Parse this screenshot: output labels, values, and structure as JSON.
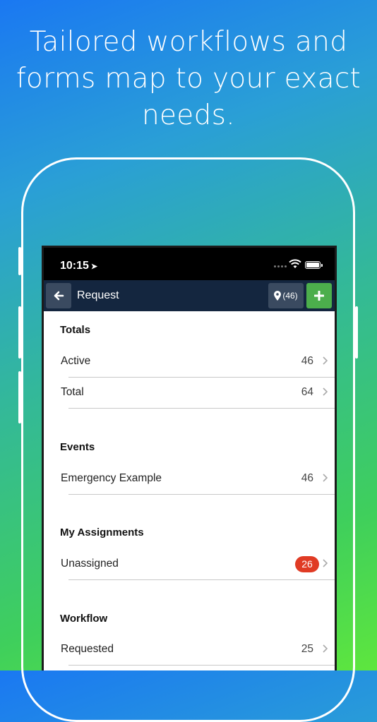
{
  "headline": {
    "line1": "Tailored workflows and",
    "line2": "forms map to your exact",
    "line3": "needs."
  },
  "status_bar": {
    "time": "10:15",
    "location_icon": "location-arrow-icon"
  },
  "nav": {
    "back_icon": "arrow-left-icon",
    "title": "Request",
    "map_count": "(46)",
    "add_icon": "plus-icon"
  },
  "sections": {
    "totals": {
      "title": "Totals",
      "rows": [
        {
          "label": "Active",
          "count": "46"
        },
        {
          "label": "Total",
          "count": "64"
        }
      ]
    },
    "events": {
      "title": "Events",
      "rows": [
        {
          "label": "Emergency Example",
          "count": "46"
        }
      ]
    },
    "assignments": {
      "title": "My Assignments",
      "rows": [
        {
          "label": "Unassigned",
          "count": "26"
        }
      ]
    },
    "workflow": {
      "title": "Workflow",
      "rows": [
        {
          "label": "Requested",
          "count": "25"
        }
      ]
    }
  },
  "colors": {
    "navbar": "#14263f",
    "add_button": "#4cae4c",
    "badge": "#e03b24"
  }
}
